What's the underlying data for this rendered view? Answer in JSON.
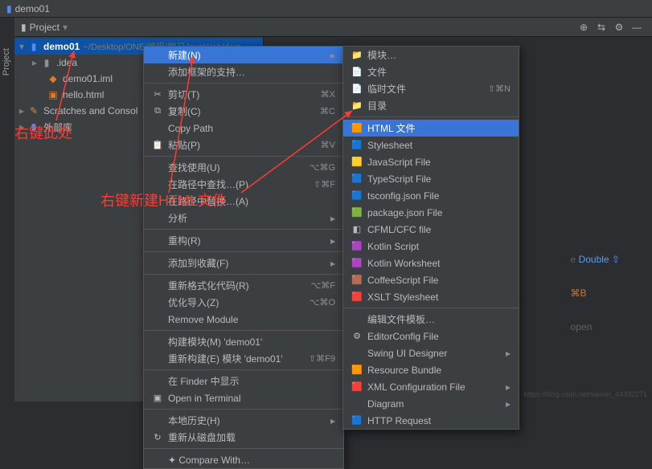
{
  "titlebar": {
    "project_name": "demo01"
  },
  "toolbar": {
    "label": "Project"
  },
  "tree": {
    "root": {
      "name": "demo01",
      "path": "~/Desktop/ONE/编程/学习JavaWeb/dem"
    },
    "idea_folder": ".idea",
    "iml_file": "demo01.iml",
    "hello_file": "hello.html",
    "scratches": "Scratches and Consol",
    "external": "外部库"
  },
  "annotations": {
    "right_click_here": "右键此处",
    "right_click_new_html": "右键新建HTML文件"
  },
  "hints": {
    "line1_blue": "Double",
    "line1_sym": "⇧",
    "line2_kbd": "⌘B",
    "line3_text": "open"
  },
  "menu1": [
    {
      "label": "新建(N)",
      "highlight": true,
      "arrow": true
    },
    {
      "label": "添加框架的支持…"
    },
    {
      "sep": true
    },
    {
      "icon": "✂",
      "label": "剪切(T)",
      "shortcut": "⌘X"
    },
    {
      "icon": "⧉",
      "label": "复制(C)",
      "shortcut": "⌘C"
    },
    {
      "label": "Copy Path"
    },
    {
      "icon": "📋",
      "label": "粘贴(P)",
      "shortcut": "⌘V"
    },
    {
      "sep": true
    },
    {
      "label": "查找使用(U)",
      "shortcut": "⌥⌘G"
    },
    {
      "label": "在路径中查找…(P)",
      "shortcut": "⇧⌘F"
    },
    {
      "label": "在路径中替换…(A)"
    },
    {
      "label": "分析",
      "arrow": true
    },
    {
      "sep": true
    },
    {
      "label": "重构(R)",
      "arrow": true
    },
    {
      "sep": true
    },
    {
      "label": "添加到收藏(F)",
      "arrow": true
    },
    {
      "sep": true
    },
    {
      "label": "重新格式化代码(R)",
      "shortcut": "⌥⌘F"
    },
    {
      "label": "优化导入(Z)",
      "shortcut": "⌥⌘O"
    },
    {
      "label": "Remove Module"
    },
    {
      "sep": true
    },
    {
      "label": "构建模块(M) 'demo01'"
    },
    {
      "label": "重新构建(E) 模块 'demo01'",
      "shortcut": "⇧⌘F9"
    },
    {
      "sep": true
    },
    {
      "label": "在 Finder 中显示"
    },
    {
      "icon": "▣",
      "label": "Open in Terminal"
    },
    {
      "sep": true
    },
    {
      "label": "本地历史(H)",
      "arrow": true
    },
    {
      "icon": "↻",
      "label": "重新从磁盘加载"
    },
    {
      "sep": true
    },
    {
      "label": "✦ Compare With…"
    }
  ],
  "menu2": [
    {
      "icon": "📁",
      "label": "模块…"
    },
    {
      "icon": "📄",
      "label": "文件"
    },
    {
      "icon": "📄",
      "label": "临时文件",
      "shortcut": "⇧⌘N"
    },
    {
      "icon": "📁",
      "label": "目录"
    },
    {
      "sep": true
    },
    {
      "icon": "🟧",
      "label": "HTML 文件",
      "highlight": true
    },
    {
      "icon": "🟦",
      "label": "Stylesheet"
    },
    {
      "icon": "🟨",
      "label": "JavaScript File"
    },
    {
      "icon": "🟦",
      "label": "TypeScript File"
    },
    {
      "icon": "🟦",
      "label": "tsconfig.json File"
    },
    {
      "icon": "🟩",
      "label": "package.json File"
    },
    {
      "icon": "◧",
      "label": "CFML/CFC file"
    },
    {
      "icon": "🟪",
      "label": "Kotlin Script"
    },
    {
      "icon": "🟪",
      "label": "Kotlin Worksheet"
    },
    {
      "icon": "🟫",
      "label": "CoffeeScript File"
    },
    {
      "icon": "🟥",
      "label": "XSLT Stylesheet"
    },
    {
      "sep": true
    },
    {
      "label": "编辑文件模板…"
    },
    {
      "icon": "⚙",
      "label": "EditorConfig File"
    },
    {
      "label": "Swing UI Designer",
      "arrow": true
    },
    {
      "icon": "🟧",
      "label": "Resource Bundle"
    },
    {
      "icon": "🟥",
      "label": "XML Configuration File",
      "arrow": true
    },
    {
      "label": "Diagram",
      "arrow": true
    },
    {
      "icon": "🟦",
      "label": "HTTP Request"
    }
  ],
  "watermark": "https://blog.csdn.net/weixin_44392271"
}
